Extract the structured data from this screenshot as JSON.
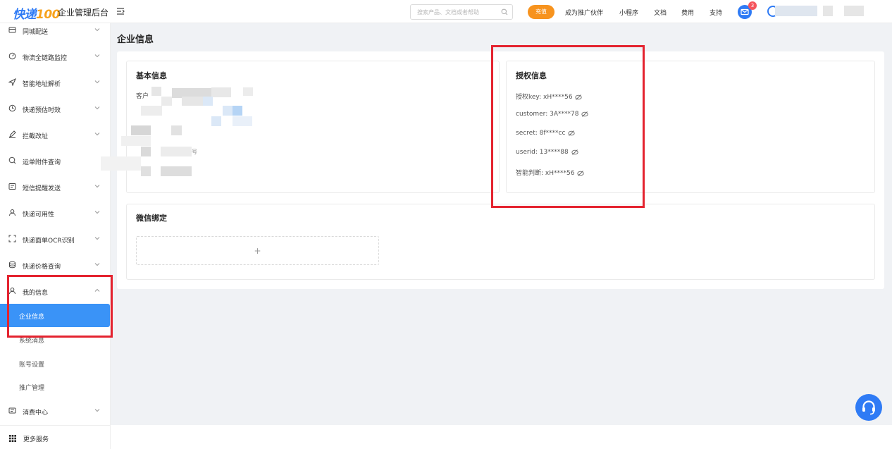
{
  "header": {
    "logo_text": "快递",
    "logo_num": "100",
    "brand_sub": "企业管理后台",
    "search_placeholder": "搜索产品、文档或者帮助",
    "recharge": "充值",
    "nav": [
      "成为推广伙伴",
      "小程序",
      "文档",
      "费用",
      "支持"
    ],
    "mail_badge": "3"
  },
  "sidebar": {
    "items": [
      {
        "label": "同城配送",
        "icon": "delivery-icon"
      },
      {
        "label": "物流全链路监控",
        "icon": "gauge-icon"
      },
      {
        "label": "智能地址解析",
        "icon": "send-icon"
      },
      {
        "label": "快递预估时效",
        "icon": "clock-icon"
      },
      {
        "label": "拦截改址",
        "icon": "edit-icon"
      },
      {
        "label": "运单附件查询",
        "icon": "search-icon"
      },
      {
        "label": "短信提醒发送",
        "icon": "message-icon"
      },
      {
        "label": "快递可用性",
        "icon": "user-icon"
      },
      {
        "label": "快递面单OCR识别",
        "icon": "scan-icon"
      },
      {
        "label": "快递价格查询",
        "icon": "database-icon"
      },
      {
        "label": "我的信息",
        "icon": "user-icon"
      }
    ],
    "sub_items": [
      "企业信息",
      "系统消息",
      "账号设置",
      "推广管理"
    ],
    "consume": "消费中心",
    "more": "更多服务"
  },
  "main": {
    "page_title": "企业信息",
    "basic": {
      "title": "基本信息",
      "customer_label": "客户",
      "blur_tail": "号"
    },
    "auth": {
      "title": "授权信息",
      "rows": [
        {
          "label": "授权key:",
          "value": "xH****56"
        },
        {
          "label": "customer:",
          "value": "3A****78"
        },
        {
          "label": "secret:",
          "value": "8f****cc"
        },
        {
          "label": "userid:",
          "value": "13****88"
        },
        {
          "label": "智能判断:",
          "value": "xH****56"
        }
      ]
    },
    "wechat": {
      "title": "微信绑定",
      "add": "+"
    }
  },
  "colors": {
    "accent": "#3a93f7",
    "brand": "#2f7bf5",
    "recharge": "#f7931e",
    "highlight": "#e4232f"
  }
}
